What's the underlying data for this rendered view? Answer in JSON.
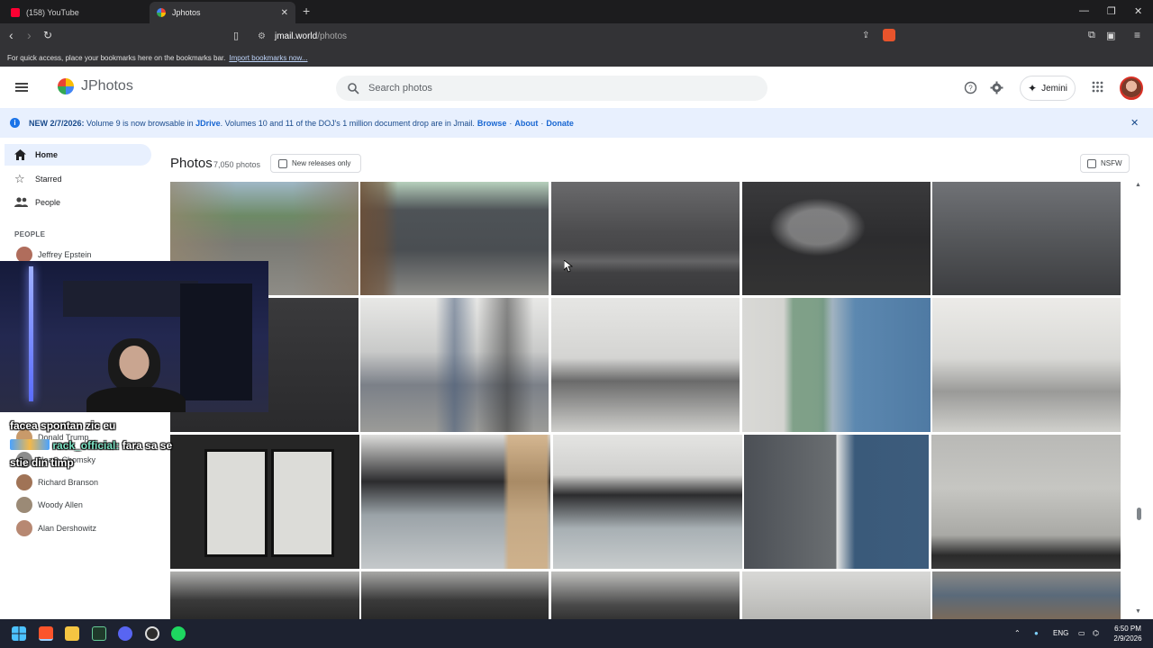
{
  "browser": {
    "tabs": [
      {
        "label": "(158) YouTube",
        "active": false
      },
      {
        "label": "Jphotos",
        "active": true
      }
    ],
    "url_host": "jmail.world",
    "url_path": "/photos",
    "bookmarks_hint": "For quick access, place your bookmarks here on the bookmarks bar.",
    "bookmarks_import": "Import bookmarks now..."
  },
  "app": {
    "brand": "JPhotos",
    "search_placeholder": "Search photos",
    "jemini_label": "Jemini"
  },
  "banner": {
    "new_label": "NEW 2/7/2026:",
    "text_1": "Volume 9 is now browsable in",
    "jdrive": "JDrive",
    "text_2": ". Volumes 10 and 11 of the DOJ's 1 million document drop are in Jmail.",
    "browse": "Browse",
    "about": "About",
    "donate": "Donate"
  },
  "sidebar": {
    "nav": [
      {
        "label": "Home",
        "icon": "home-icon",
        "active": true
      },
      {
        "label": "Starred",
        "icon": "star-icon",
        "active": false
      },
      {
        "label": "People",
        "icon": "people-icon",
        "active": false
      }
    ],
    "people_heading": "PEOPLE",
    "people": [
      {
        "name": "Jeffrey Epstein",
        "color": "#b06d5c"
      },
      {
        "name": "Donald Trump",
        "color": "#c89a6a"
      },
      {
        "name": "Noam Chomsky",
        "color": "#8c8c8c"
      },
      {
        "name": "Richard Branson",
        "color": "#a07356"
      },
      {
        "name": "Woody Allen",
        "color": "#9b8a76"
      },
      {
        "name": "Alan Dershowitz",
        "color": "#b78872"
      }
    ]
  },
  "main": {
    "title": "Photos",
    "count": "7,050 photos",
    "new_releases": "New releases only",
    "nsfw": "NSFW"
  },
  "chat": [
    {
      "user": "",
      "text": "facea spontan zic eu"
    },
    {
      "user": "rack_official:",
      "text": "fara sa se"
    },
    {
      "user": "",
      "text": "stie din timp"
    }
  ],
  "taskbar": {
    "lang": "ENG",
    "time": "6:50 PM",
    "date": "2/9/2026"
  },
  "colors": {
    "accent": "#1a73e8",
    "banner_bg": "#e8f0fe",
    "nav_active_bg": "#e8f0fe"
  }
}
